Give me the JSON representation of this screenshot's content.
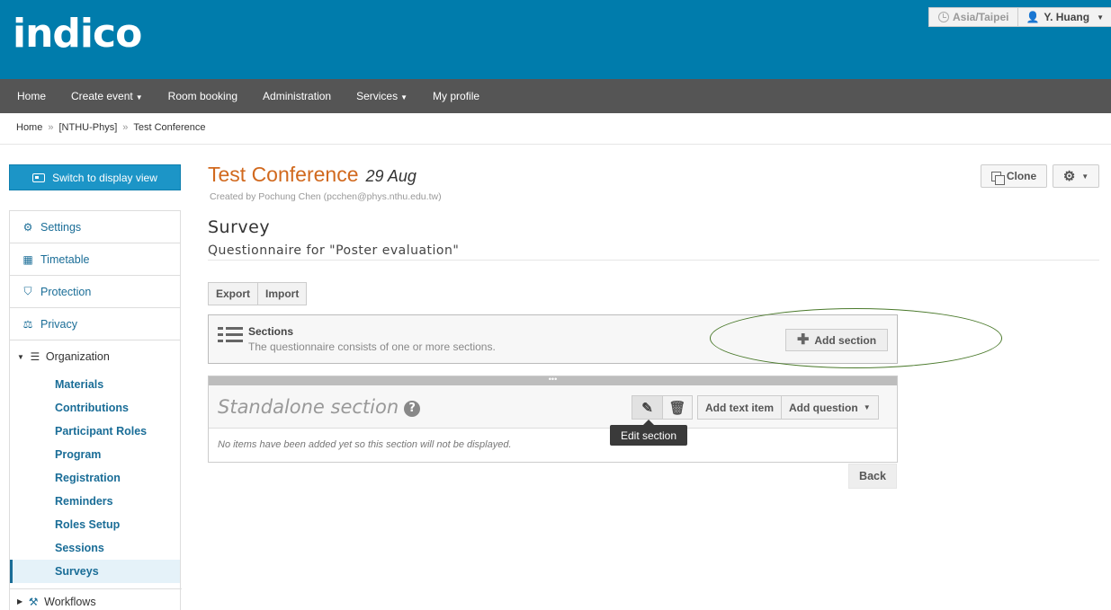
{
  "header": {
    "logo": "indico",
    "timezone": "Asia/Taipei",
    "user": "Y. Huang"
  },
  "nav": {
    "items": [
      "Home",
      "Create event",
      "Room booking",
      "Administration",
      "Services",
      "My profile"
    ]
  },
  "breadcrumb": {
    "items": [
      "Home",
      "[NTHU-Phys]",
      "Test Conference"
    ],
    "separator": "»"
  },
  "sidebar": {
    "switch_label": "Switch to display view",
    "items": [
      "Settings",
      "Timetable",
      "Protection",
      "Privacy"
    ],
    "organization": {
      "label": "Organization",
      "subitems": [
        "Materials",
        "Contributions",
        "Participant Roles",
        "Program",
        "Registration",
        "Reminders",
        "Roles Setup",
        "Sessions",
        "Surveys"
      ],
      "active": "Surveys"
    },
    "workflows": "Workflows"
  },
  "event": {
    "title": "Test Conference",
    "date": "29 Aug",
    "created_by": "Created by Pochung Chen (pcchen@phys.nthu.edu.tw)",
    "clone_label": "Clone"
  },
  "page": {
    "title": "Survey",
    "subtitle": "Questionnaire for \"Poster evaluation\"",
    "export_label": "Export",
    "import_label": "Import"
  },
  "sections_box": {
    "label": "Sections",
    "description": "The questionnaire consists of one or more sections.",
    "add_label": "Add section"
  },
  "standalone": {
    "handle": "•••",
    "title": "Standalone section",
    "help": "?",
    "add_text_label": "Add text item",
    "add_question_label": "Add question",
    "empty_message": "No items have been added yet so this section will not be displayed."
  },
  "tooltip": "Edit section",
  "back_label": "Back",
  "colors": {
    "header": "#007cac",
    "nav": "#555555",
    "title": "#d1691e",
    "link": "#1a6d97",
    "annotation": "#4b7a2c"
  }
}
